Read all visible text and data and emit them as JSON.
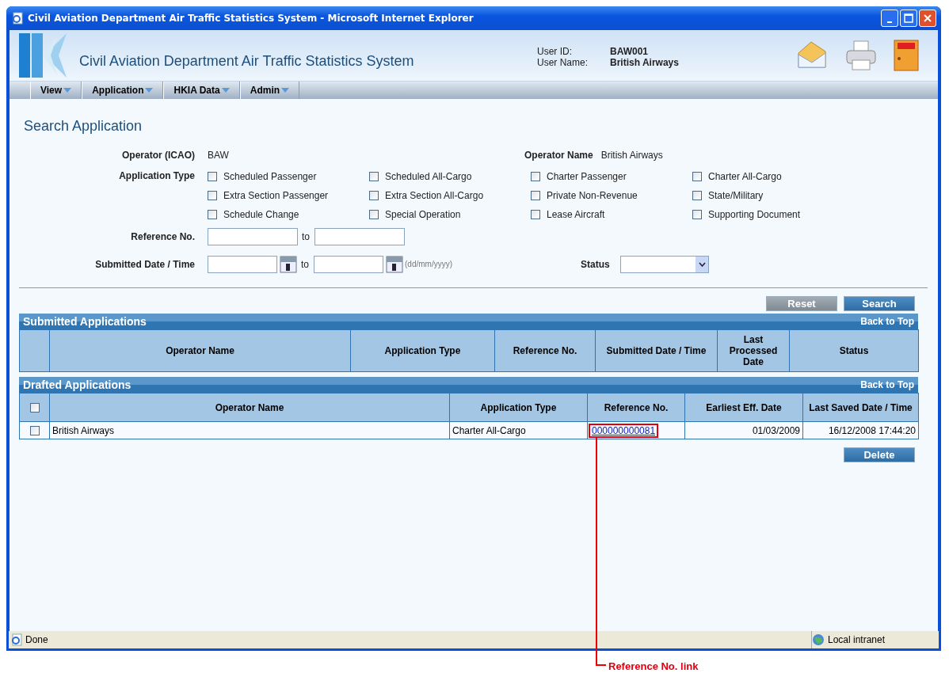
{
  "window": {
    "title": "Civil Aviation Department Air Traffic Statistics System - Microsoft Internet Explorer"
  },
  "header": {
    "app_title": "Civil Aviation Department Air Traffic Statistics System",
    "user_id_label": "User ID:",
    "user_id": "BAW001",
    "user_name_label": "User Name:",
    "user_name": "British Airways"
  },
  "menu": [
    {
      "label": "View"
    },
    {
      "label": "Application"
    },
    {
      "label": "HKIA Data"
    },
    {
      "label": "Admin"
    }
  ],
  "page_title": "Search Application",
  "form": {
    "operator_icao_label": "Operator (ICAO)",
    "operator_icao": "BAW",
    "operator_name_label": "Operator Name",
    "operator_name": "British Airways",
    "application_type_label": "Application Type",
    "application_types": [
      {
        "label": "Scheduled Passenger",
        "checked": false
      },
      {
        "label": "Scheduled All-Cargo",
        "checked": false
      },
      {
        "label": "Charter Passenger",
        "checked": false
      },
      {
        "label": "Charter All-Cargo",
        "checked": false
      },
      {
        "label": "Extra Section Passenger",
        "checked": false
      },
      {
        "label": "Extra Section All-Cargo",
        "checked": false
      },
      {
        "label": "Private Non-Revenue",
        "checked": false
      },
      {
        "label": "State/Military",
        "checked": false
      },
      {
        "label": "Schedule Change",
        "checked": false
      },
      {
        "label": "Special Operation",
        "checked": false
      },
      {
        "label": "Lease Aircraft",
        "checked": false
      },
      {
        "label": "Supporting Document",
        "checked": false
      }
    ],
    "reference_label": "Reference No.",
    "reference_to": "to",
    "submitted_label": "Submitted Date / Time",
    "submitted_to": "to",
    "date_format_hint": "(dd/mm/yyyy)",
    "status_label": "Status"
  },
  "search_buttons": [
    {
      "label": "Reset",
      "kind": "secondary"
    },
    {
      "label": "Search",
      "kind": "primary"
    }
  ],
  "submitted": {
    "title": "Submitted Applications",
    "back_to_top": "Back to Top",
    "columns": [
      "Operator Name",
      "Application Type",
      "Reference No.",
      "Submitted Date / Time",
      "Last Processed Date",
      "Status"
    ]
  },
  "drafted": {
    "title": "Drafted Applications",
    "back_to_top": "Back to Top",
    "select_all_checked": false,
    "columns": [
      "Operator Name",
      "Application Type",
      "Reference No.",
      "Earliest Eff. Date",
      "Last Saved Date / Time"
    ],
    "rows": [
      {
        "checked": false,
        "operator_name": "British Airways",
        "application_type": "Charter All-Cargo",
        "reference_no": "000000000081",
        "earliest_eff_date": "01/03/2009",
        "last_saved": "16/12/2008 17:44:20"
      }
    ]
  },
  "delete_button": "Delete",
  "status_bar": {
    "text": "Done",
    "zone": "Local intranet"
  },
  "annotation": {
    "label": "Reference No. link"
  }
}
